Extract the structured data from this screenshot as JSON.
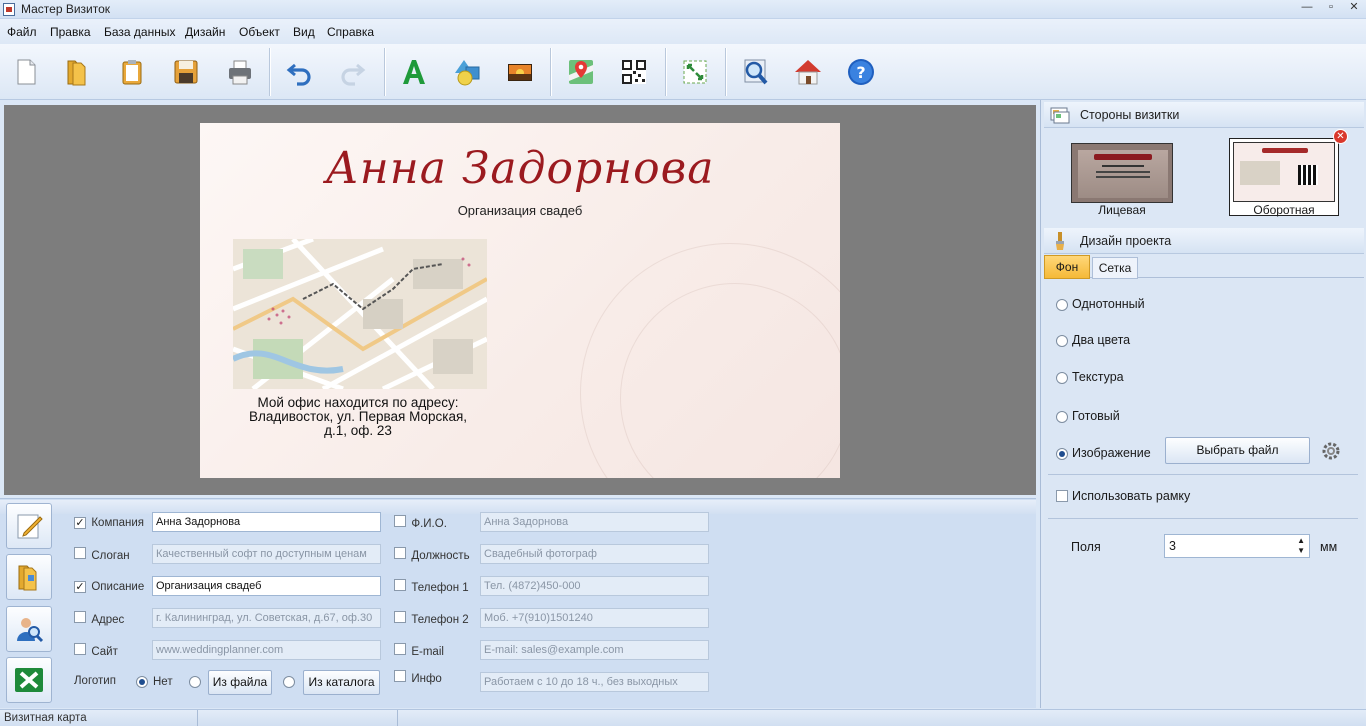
{
  "window": {
    "title": "Мастер Визиток",
    "controls": [
      "—",
      "▫",
      "✕"
    ]
  },
  "menu": [
    "Файл",
    "Правка",
    "База данных",
    "Дизайн",
    "Объект",
    "Вид",
    "Справка"
  ],
  "toolbar": {
    "icons": [
      "new-file-icon",
      "open-folder-icon",
      "clipboard-icon",
      "save-icon",
      "print-icon",
      "undo-icon",
      "redo-icon",
      "text-icon",
      "shapes-icon",
      "image-icon",
      "map-icon",
      "qr-code-icon",
      "fit-to-page-icon",
      "zoom-preview-icon",
      "home-icon",
      "help-icon"
    ],
    "colors": {
      "undo": "#2f6fbf",
      "text": "#1f9a3a",
      "help": "#1f5fbf"
    }
  },
  "card": {
    "name": "Анна Задорнова",
    "org": "Организация свадеб",
    "address_lines": [
      "Мой офис находится по адресу:",
      "Владивосток, ул. Первая Морская,",
      "д.1, оф. 23"
    ],
    "name_color": "#9b1a1f"
  },
  "form": {
    "left": [
      {
        "label": "Компания",
        "value": "Анна Задорнова",
        "checked": true
      },
      {
        "label": "Слоган",
        "value": "Качественный софт по доступным ценам",
        "checked": false
      },
      {
        "label": "Описание",
        "value": "Организация свадеб",
        "checked": true
      },
      {
        "label": "Адрес",
        "value": "г. Калининград, ул. Советская, д.67, оф.30",
        "checked": false
      },
      {
        "label": "Сайт",
        "value": "www.weddingplanner.com",
        "checked": false
      }
    ],
    "right": [
      {
        "label": "Ф.И.О.",
        "value": "Анна Задорнова",
        "checked": false
      },
      {
        "label": "Должность",
        "value": "Свадебный фотограф",
        "checked": false
      },
      {
        "label": "Телефон 1",
        "value": "Тел. (4872)450-000",
        "checked": false
      },
      {
        "label": "Телефон 2",
        "value": "Моб. +7(910)1501240",
        "checked": false
      },
      {
        "label": "E-mail",
        "value": "E-mail: sales@example.com",
        "checked": false
      },
      {
        "label": "Инфо",
        "value": "Работаем с 10 до 18 ч., без выходных",
        "checked": false
      }
    ],
    "logo": {
      "label": "Логотип",
      "option_none": "Нет",
      "from_file": "Из файла",
      "from_catalog": "Из каталога"
    },
    "side_buttons": [
      "edit-card-icon",
      "database-folder-icon",
      "find-contact-icon",
      "excel-icon"
    ]
  },
  "sides": {
    "header": "Стороны визитки",
    "front": "Лицевая",
    "back": "Оборотная"
  },
  "design": {
    "header": "Дизайн проекта",
    "tabs": [
      "Фон",
      "Сетка"
    ],
    "options": [
      "Однотонный",
      "Два цвета",
      "Текстура",
      "Готовый",
      "Изображение"
    ],
    "selected_option": "Изображение",
    "choose_file": "Выбрать файл",
    "use_frame": "Использовать рамку",
    "margins_label": "Поля",
    "margins_value": "3",
    "margins_unit": "мм"
  },
  "status": {
    "text": "Визитная карта"
  }
}
